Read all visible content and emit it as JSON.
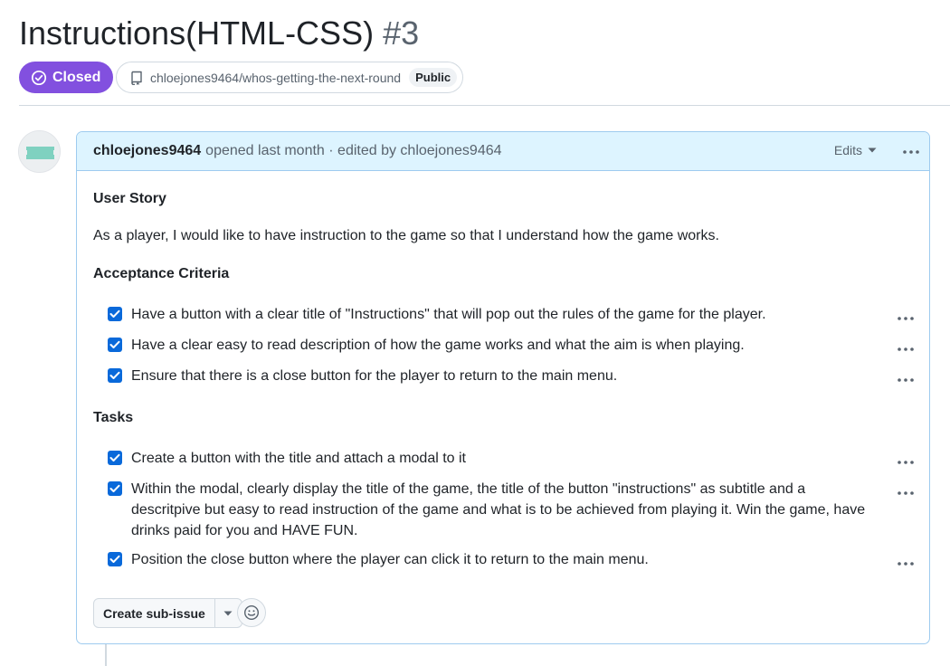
{
  "issue": {
    "title": "Instructions(HTML-CSS)",
    "number": "#3",
    "state": "Closed",
    "repo": "chloejones9464/whos-getting-the-next-round",
    "visibility": "Public"
  },
  "comment": {
    "author": "chloejones9464",
    "meta": "opened last month · edited by chloejones9464",
    "edits_label": "Edits",
    "user_story_heading": "User Story",
    "user_story_text": "As a player, I would like to have instruction to the game so that I understand how the game works.",
    "acceptance_heading": "Acceptance Criteria",
    "acceptance_items": [
      {
        "text": "Have a button with a clear title of \"Instructions\" that will pop out the rules of the game for the player.",
        "checked": true
      },
      {
        "text": "Have a clear easy to read description of how the game works and what the aim is when playing.",
        "checked": true
      },
      {
        "text": "Ensure that there is a close button for the player to return to the main menu.",
        "checked": true
      }
    ],
    "tasks_heading": "Tasks",
    "task_items": [
      {
        "text": "Create a button with the title and attach a modal to it",
        "checked": true
      },
      {
        "text": "Within the modal, clearly display the title of the game, the title of the button \"instructions\" as subtitle and a descritpive but easy to read instruction of the game and what is to be achieved from playing it. Win the game, have drinks paid for you and HAVE FUN.",
        "checked": true
      },
      {
        "text": "Position the close button where the player can click it to return to the main menu.",
        "checked": true
      }
    ],
    "create_sub_issue_label": "Create sub-issue"
  },
  "colors": {
    "closed_badge": "#8250df",
    "header_bg": "#ddf4ff",
    "checkbox": "#0969da",
    "border": "#d1d9e0"
  },
  "icons": {
    "state": "check-circle-icon",
    "repo": "repo-icon",
    "more": "kebab-horizontal-icon",
    "caret": "triangle-down-icon",
    "reaction": "smiley-icon"
  }
}
